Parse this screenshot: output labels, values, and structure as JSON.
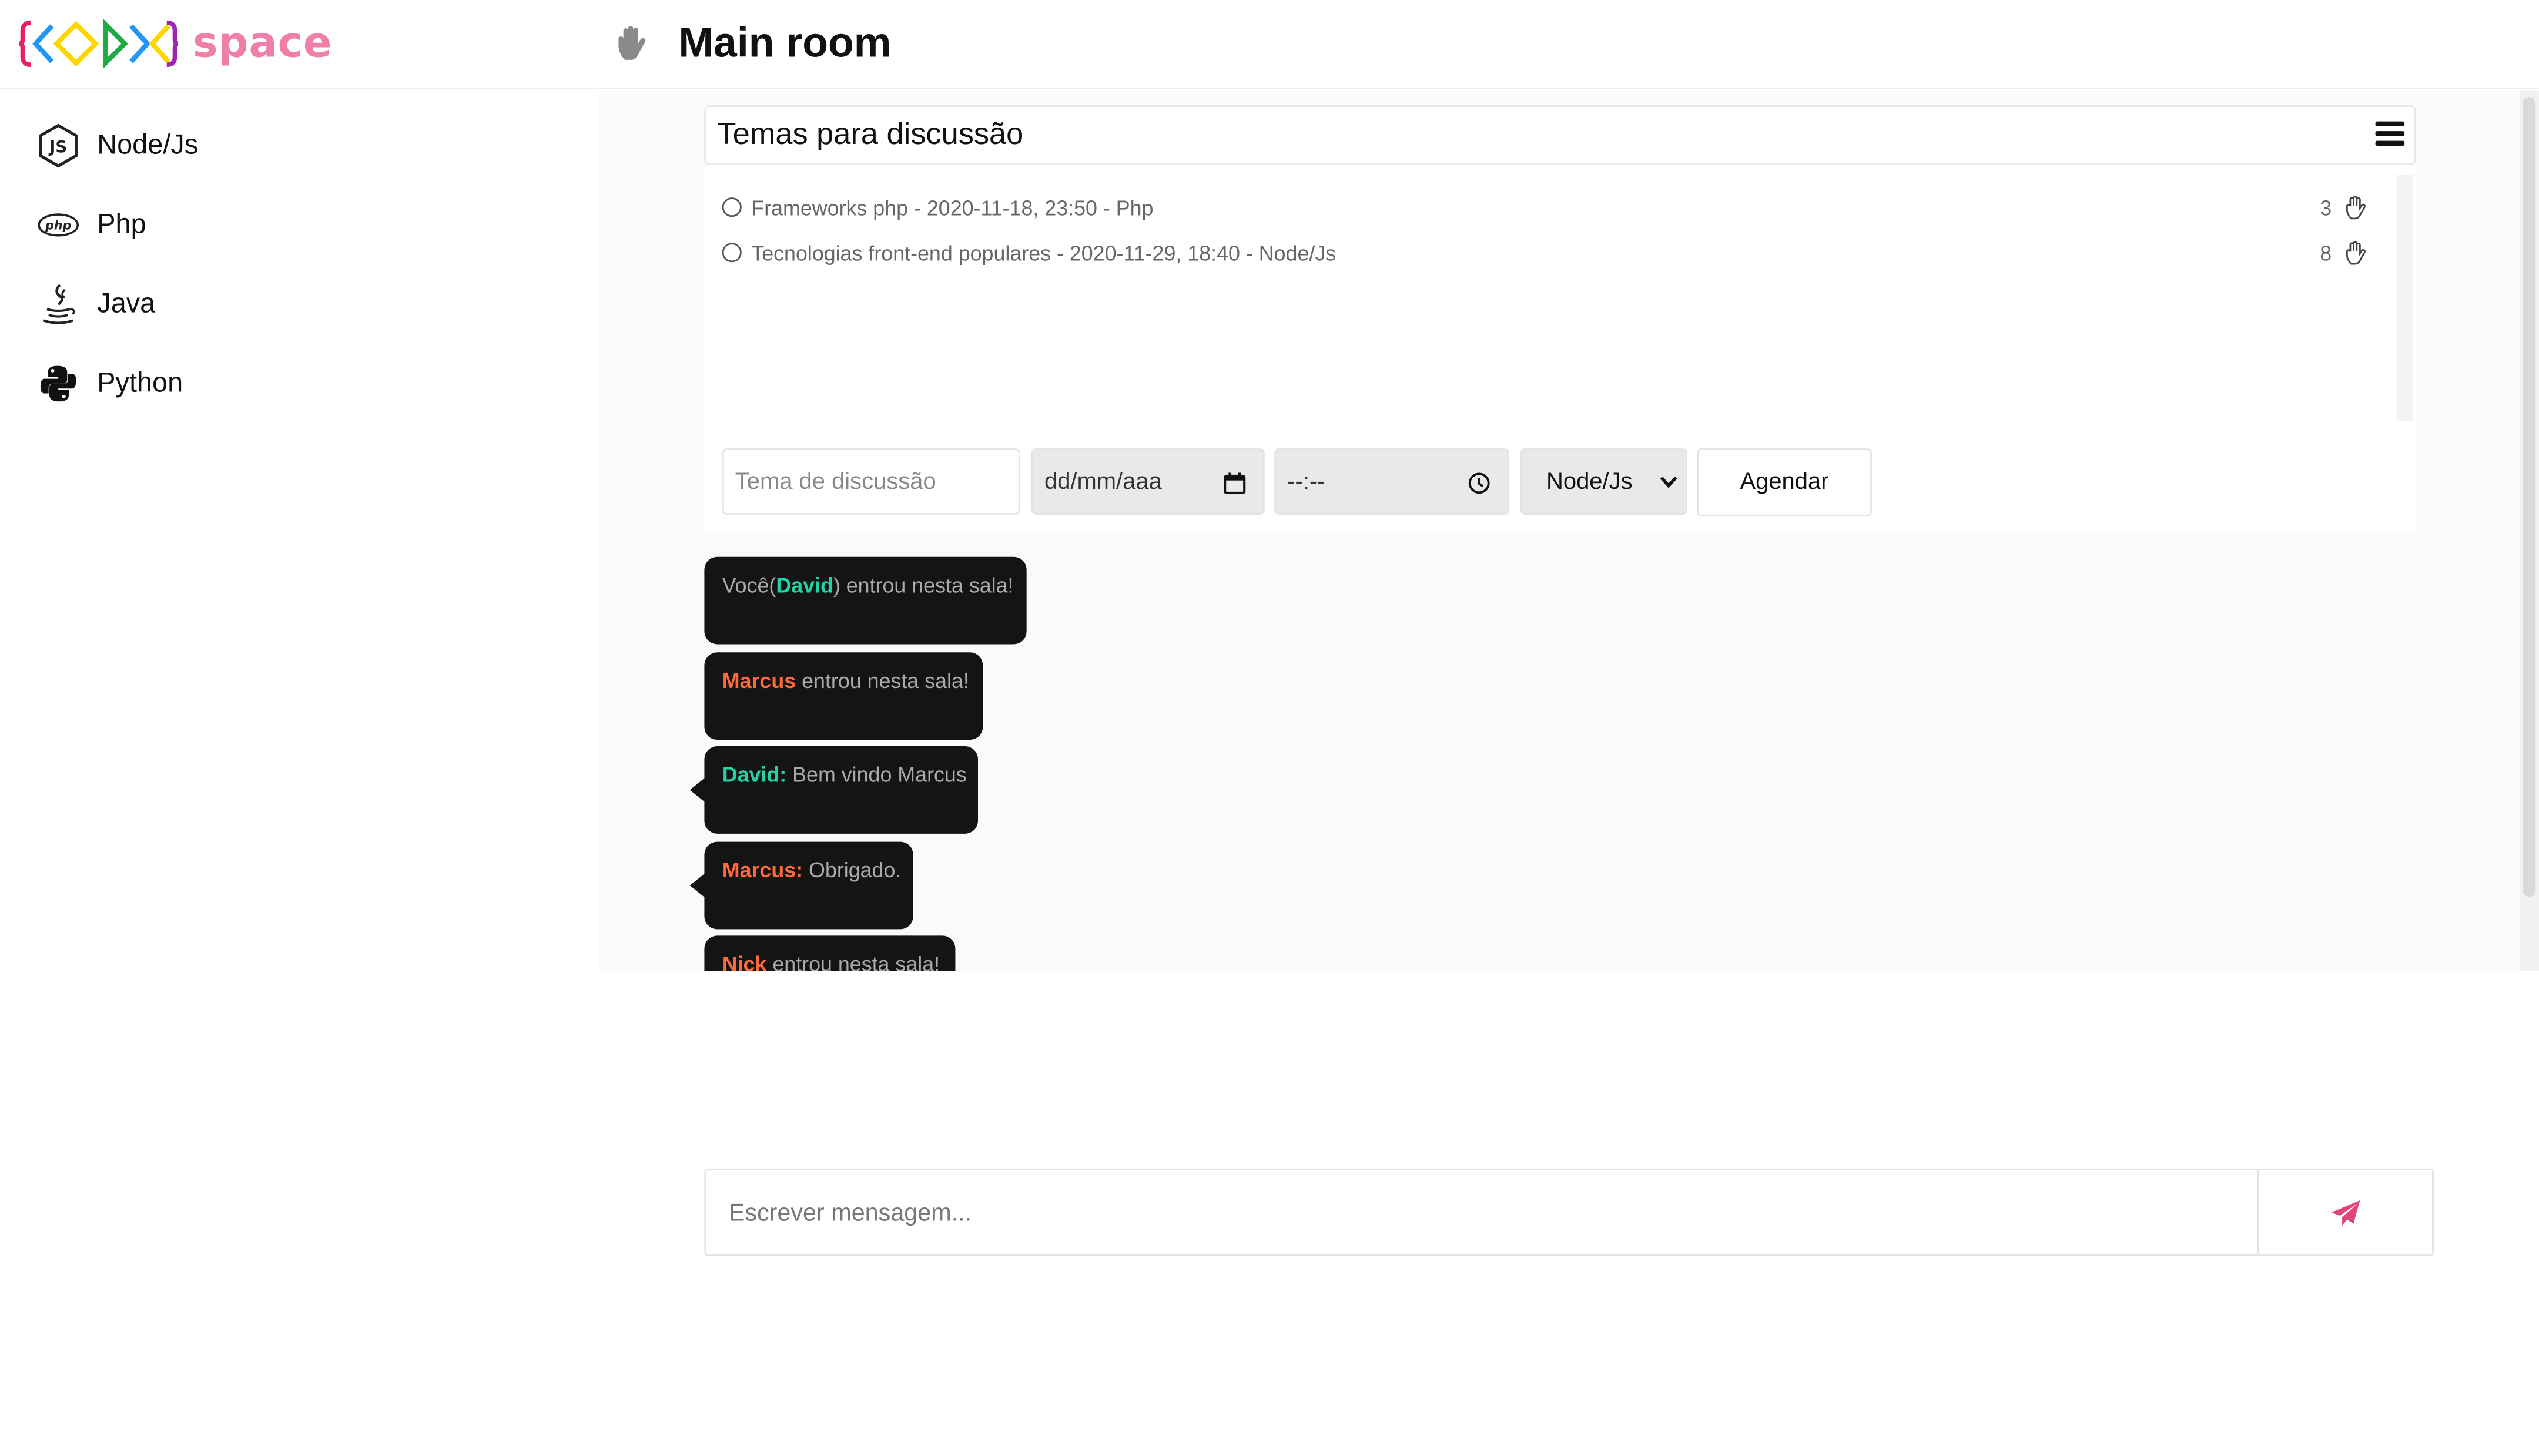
{
  "app": {
    "logo_word": "space",
    "logo_alt": "KODE",
    "room_title": "Main room"
  },
  "colors": {
    "brand_pink": "#ef7fa8",
    "user_self": "#22d3a5",
    "user_other": "#ff6a3d",
    "bubble_bg": "#141414",
    "send_icon": "#e0457b"
  },
  "sidebar": {
    "items": [
      {
        "label": "Node/Js",
        "icon": "nodejs-icon"
      },
      {
        "label": "Php",
        "icon": "php-icon"
      },
      {
        "label": "Java",
        "icon": "java-icon"
      },
      {
        "label": "Python",
        "icon": "python-icon"
      }
    ]
  },
  "topics": {
    "title": "Temas para discussão",
    "items": [
      {
        "text": "Frameworks php - 2020-11-18, 23:50 - Php",
        "count": "3"
      },
      {
        "text": "Tecnologias front-end populares - 2020-11-29, 18:40 - Node/Js",
        "count": "8"
      }
    ],
    "form": {
      "topic_placeholder": "Tema de discussão",
      "date_placeholder": "dd/mm/aaa",
      "time_placeholder": "--:--",
      "language_selected": "Node/Js",
      "submit_label": "Agendar"
    }
  },
  "messages": [
    {
      "pre": "Você(",
      "user": "David",
      "post": ") entrou nesta sala!",
      "color": "green"
    },
    {
      "pre": "",
      "user": "Marcus",
      "post": " entrou nesta sala!",
      "color": "orange"
    },
    {
      "pre": "",
      "user": "David:",
      "post": " Bem vindo Marcus",
      "color": "green"
    },
    {
      "pre": "",
      "user": "Marcus:",
      "post": " Obrigado.",
      "color": "orange"
    },
    {
      "pre": "",
      "user": "Nick",
      "post": " entrou nesta sala!",
      "color": "orange"
    }
  ],
  "compose": {
    "placeholder": "Escrever mensagem...",
    "send_icon": "paper-plane-icon"
  }
}
